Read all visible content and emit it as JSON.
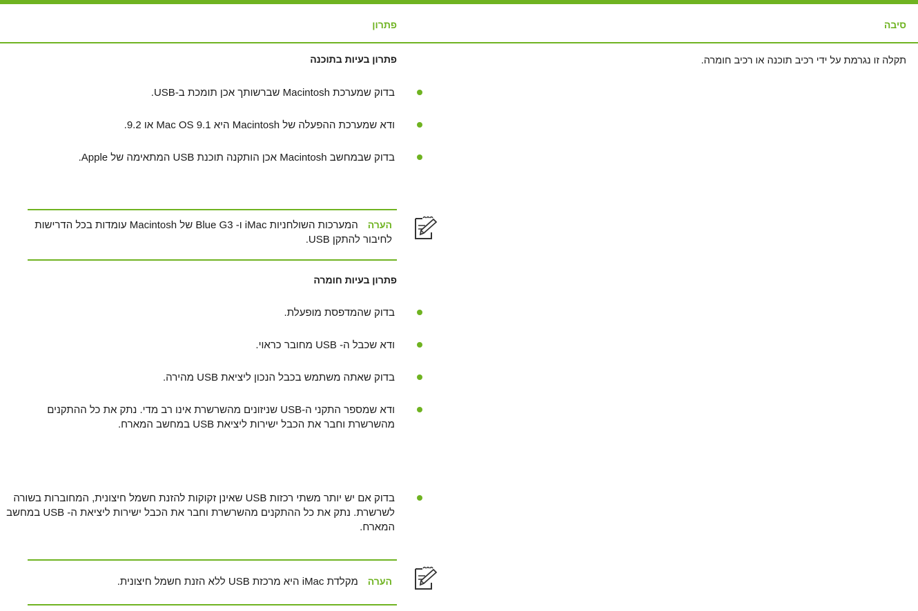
{
  "header": {
    "cause_label": "סיבה",
    "solution_label": "פתרון"
  },
  "cause": {
    "text": "תקלה זו נגרמת על ידי רכיב תוכנה או רכיב חומרה."
  },
  "software": {
    "title": "פתרון בעיות בתוכנה",
    "bullets": [
      "בדוק שמערכת Macintosh שברשותך אכן תומכת ב-USB.",
      "ודא שמערכת ההפעלה של Macintosh היא Mac OS 9.1 או 9.2.",
      "בדוק שבמחשב Macintosh אכן הותקנה תוכנת USB המתאימה של Apple."
    ],
    "note": {
      "label": "הערה",
      "text": "המערכות השולחניות iMac ו- Blue G3 של Macintosh עומדות בכל הדרישות לחיבור להתקן USB."
    }
  },
  "hardware": {
    "title": "פתרון בעיות חומרה",
    "bullets": [
      "בדוק שהמדפסת מופעלת.",
      "ודא שכבל ה- USB מחובר כראוי.",
      "בדוק שאתה משתמש בכבל הנכון ליציאת USB מהירה.",
      "ודא שמספר התקני ה-USB שניזונים מהשרשרת אינו רב מדי. נתק את כל ההתקנים מהשרשרת וחבר את הכבל ישירות ליציאת USB במחשב המארח.",
      "בדוק אם יש יותר משתי רכזות USB שאינן זקוקות להזנת חשמל חיצונית, המחוברות בשורה לשרשרת. נתק את כל ההתקנים מהשרשרת וחבר את הכבל ישירות ליציאת ה- USB במחשב המארח."
    ],
    "note": {
      "label": "הערה",
      "text": "מקלדת iMac היא מרכזת USB ללא הזנת חשמל חיצונית."
    }
  },
  "icons": {
    "note": "note-pencil-icon"
  },
  "colors": {
    "accent": "#6fb321",
    "text": "#1a1a1a"
  }
}
